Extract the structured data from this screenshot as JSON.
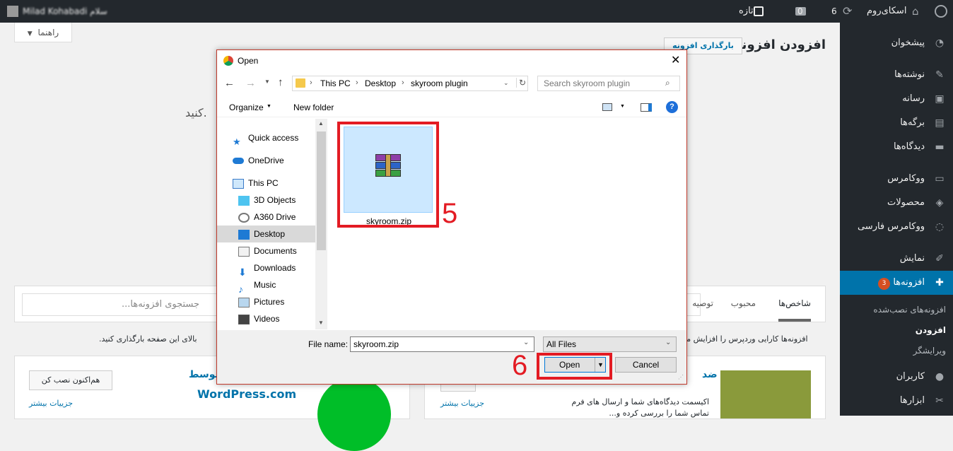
{
  "adminbar": {
    "user_name": "Milad Kohabadi سلام",
    "site_name": "اسکای‌روم",
    "updates": "6",
    "comments": "0",
    "new_label": "تازه"
  },
  "help_button": "راهنما",
  "page": {
    "title": "افزودن افزونه",
    "upload_button": "بارگذاری افزونه",
    "partial_text": "کنید.",
    "tabs": [
      "شاخص‌ها",
      "محبوب",
      "توصیه"
    ],
    "search_placeholder": "جستجوی افزونه‌ها...",
    "info_text_left": "افزونه‌ها کارایی وردپرس را افزایش مـ",
    "info_text_right": "بالای این صفحه بارگذاری کنید.",
    "card1": {
      "install_button": "هم‌اکنون نصب کن",
      "more_details": "جزییات بیشتر",
      "by_label": "توسط",
      "author": "WordPress.com"
    },
    "card2": {
      "more_details": "جزییات بیشتر",
      "title_partial": "ضد",
      "desc_line1": "اکیسمت دیدگاه‌های شما و ارسال های فرم",
      "desc_line2": "تماس شما را بررسی کرده و..."
    }
  },
  "sidebar": {
    "items": [
      {
        "label": "پیشخوان",
        "icon": "dashboard-icon"
      },
      {
        "label": "نوشته‌ها",
        "icon": "pin-icon"
      },
      {
        "label": "رسانه",
        "icon": "media-icon"
      },
      {
        "label": "برگه‌ها",
        "icon": "pages-icon"
      },
      {
        "label": "دیدگاه‌ها",
        "icon": "comments-icon"
      },
      {
        "label": "ووکامرس",
        "icon": "woo-icon"
      },
      {
        "label": "محصولات",
        "icon": "products-icon"
      },
      {
        "label": "ووکامرس فارسی",
        "icon": "woo-persian-icon"
      },
      {
        "label": "نمایش",
        "icon": "appearance-icon"
      },
      {
        "label": "افزونه‌ها",
        "icon": "plugins-icon",
        "badge": "3"
      },
      {
        "label": "کاربران",
        "icon": "users-icon"
      },
      {
        "label": "ابزارها",
        "icon": "tools-icon"
      }
    ],
    "subitems": [
      "افزونه‌های نصب‌شده",
      "افزودن",
      "ویرایشگر"
    ]
  },
  "dialog": {
    "title": "Open",
    "breadcrumb": [
      "This PC",
      "Desktop",
      "skyroom plugin"
    ],
    "search_placeholder": "Search skyroom plugin",
    "organize": "Organize",
    "new_folder": "New folder",
    "tree": [
      {
        "label": "Quick access",
        "icon": "star-icon"
      },
      {
        "label": "OneDrive",
        "icon": "cloud-icon"
      },
      {
        "label": "This PC",
        "icon": "computer-icon"
      },
      {
        "label": "3D Objects",
        "icon": "cube-icon"
      },
      {
        "label": "A360 Drive",
        "icon": "drive-icon"
      },
      {
        "label": "Desktop",
        "icon": "desktop-icon"
      },
      {
        "label": "Documents",
        "icon": "documents-icon"
      },
      {
        "label": "Downloads",
        "icon": "downloads-icon"
      },
      {
        "label": "Music",
        "icon": "music-icon"
      },
      {
        "label": "Pictures",
        "icon": "pictures-icon"
      },
      {
        "label": "Videos",
        "icon": "videos-icon"
      }
    ],
    "file_item": "skyroom.zip",
    "file_name_label": "File name:",
    "file_name_value": "skyroom.zip",
    "file_type": "All Files",
    "open_button": "Open",
    "cancel_button": "Cancel"
  },
  "annotations": {
    "step5": "5",
    "step6": "6"
  },
  "colors": {
    "accent": "#0073aa",
    "annotation": "#e31b23",
    "adminbar": "#23282d"
  }
}
